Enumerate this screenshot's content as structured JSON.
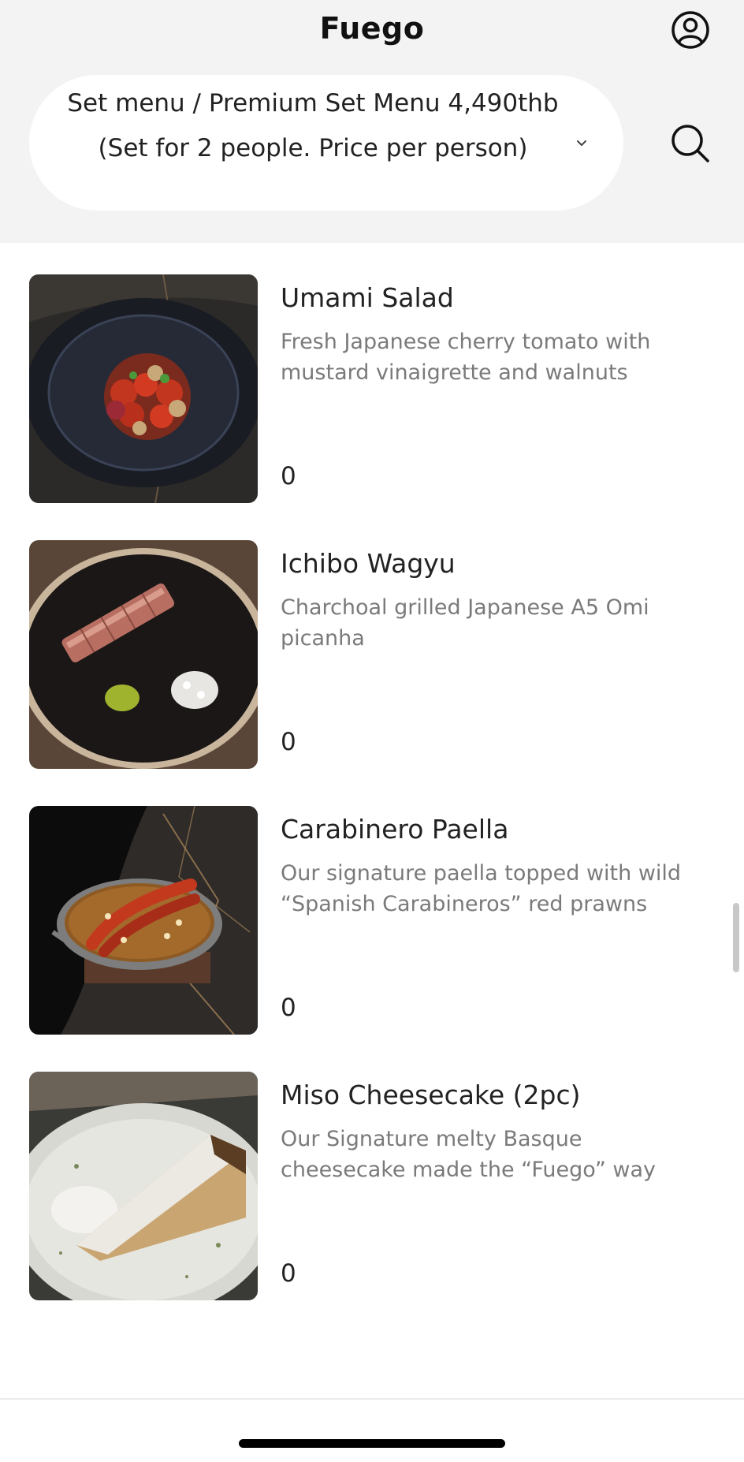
{
  "app": {
    "title": "Fuego"
  },
  "header": {
    "profile_icon": "user-circle-icon",
    "search_icon": "search-icon",
    "category": {
      "selected": "Set menu / Premium Set Menu 4,490thb (Set for 2 people. Price per person)",
      "chevron_icon": "chevron-down-icon"
    }
  },
  "menu": {
    "items": [
      {
        "name": "Umami Salad",
        "description": "Fresh Japanese cherry tomato with mustard vinaigrette and walnuts",
        "quantity": "0"
      },
      {
        "name": "Ichibo Wagyu",
        "description": "Charchoal grilled Japanese A5 Omi picanha",
        "quantity": "0"
      },
      {
        "name": "Carabinero Paella",
        "description": "Our signature paella topped with wild “Spanish Carabineros” red prawns",
        "quantity": "0"
      },
      {
        "name": "Miso Cheesecake (2pc)",
        "description": "Our Signature melty Basque cheesecake made the “Fuego” way",
        "quantity": "0"
      }
    ]
  },
  "colors": {
    "header_bg": "#f3f3f3",
    "text_primary": "#222222",
    "text_secondary": "#7a7a7a"
  }
}
